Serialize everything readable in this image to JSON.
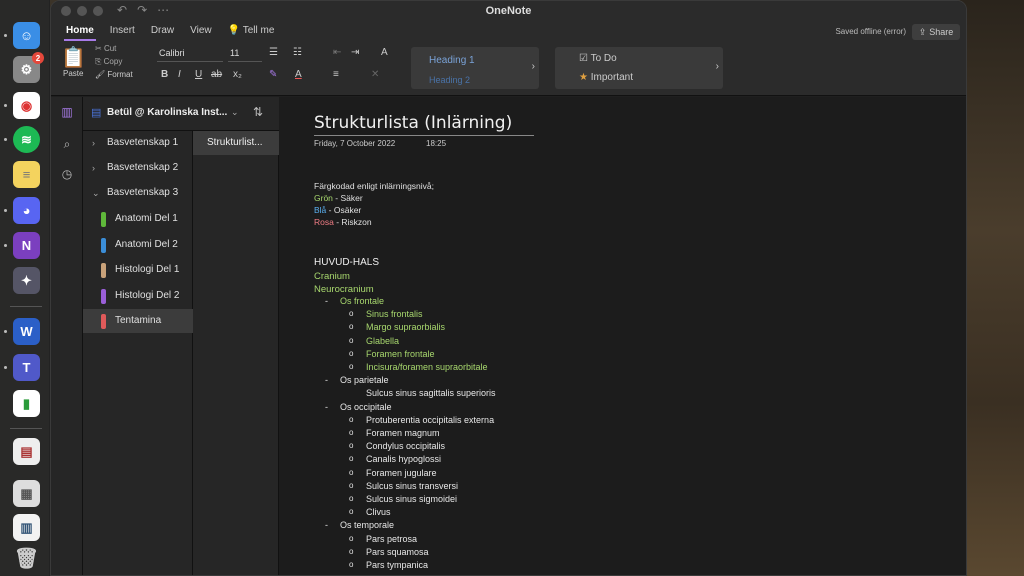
{
  "window": {
    "app_title": "OneNote"
  },
  "menu": {
    "tabs": [
      "Home",
      "Insert",
      "Draw",
      "View"
    ],
    "tell_me": "Tell me",
    "saved_status": "Saved offline (error)",
    "share": "Share"
  },
  "ribbon": {
    "paste": "Paste",
    "cut": "Cut",
    "copy": "Copy",
    "format": "Format",
    "font": "Calibri",
    "size": "11",
    "styles": {
      "primary": "Heading 1",
      "secondary": "Heading 2"
    },
    "tags": {
      "todo": "To Do",
      "important": "Important"
    }
  },
  "notebook": {
    "name": "Betül @ Karolinska Inst..."
  },
  "sections": [
    {
      "label": "Basvetenskap 1",
      "chevron": "›",
      "color": ""
    },
    {
      "label": "Basvetenskap 2",
      "chevron": "›",
      "color": ""
    },
    {
      "label": "Basvetenskap 3",
      "chevron": "⌄",
      "color": ""
    },
    {
      "label": "Anatomi Del 1",
      "chevron": "",
      "color": "#5fb83a"
    },
    {
      "label": "Anatomi Del 2",
      "chevron": "",
      "color": "#3b8ed8"
    },
    {
      "label": "Histologi Del 1",
      "chevron": "",
      "color": "#c9a27a"
    },
    {
      "label": "Histologi Del 2",
      "chevron": "",
      "color": "#9a5fd8"
    },
    {
      "label": "Tentamina",
      "chevron": "",
      "color": "#e05a5a"
    }
  ],
  "pages": [
    {
      "label": "Strukturlist..."
    }
  ],
  "note": {
    "title": "Strukturlista (Inlärning)",
    "date": "Friday, 7 October 2022",
    "time": "18:25",
    "legend_intro": "Färgkodad enligt inlärningsnivå;",
    "legend": [
      {
        "color_word": "Grön",
        "rest": " - Säker",
        "cls": "green"
      },
      {
        "color_word": "Blå",
        "rest": " - Osäker",
        "cls": "blue"
      },
      {
        "color_word": "Rosa",
        "rest": " - Riskzon",
        "cls": "pink"
      }
    ],
    "heading": "HUVUD-HALS",
    "cranium": "Cranium",
    "neurocranium": "Neurocranium",
    "outline": [
      {
        "level": 1,
        "text": "Os frontale",
        "cls": "green"
      },
      {
        "level": 2,
        "text": "Sinus frontalis",
        "cls": "green"
      },
      {
        "level": 2,
        "text": "Margo supraorbialis",
        "cls": "green"
      },
      {
        "level": 2,
        "text": "Glabella",
        "cls": "green"
      },
      {
        "level": 2,
        "text": "Foramen frontale",
        "cls": "green"
      },
      {
        "level": 2,
        "text": "Incisura/foramen supraorbitale",
        "cls": "green"
      },
      {
        "level": 1,
        "text": "Os parietale",
        "cls": ""
      },
      {
        "level": 3,
        "text": "Sulcus sinus sagittalis superioris",
        "cls": ""
      },
      {
        "level": 1,
        "text": "Os occipitale",
        "cls": ""
      },
      {
        "level": 2,
        "text": "Protuberentia occipitalis externa",
        "cls": ""
      },
      {
        "level": 2,
        "text": "Foramen magnum",
        "cls": ""
      },
      {
        "level": 2,
        "text": "Condylus occipitalis",
        "cls": ""
      },
      {
        "level": 2,
        "text": "Canalis hypoglossi",
        "cls": ""
      },
      {
        "level": 2,
        "text": "Foramen jugulare",
        "cls": ""
      },
      {
        "level": 2,
        "text": "Sulcus sinus transversi",
        "cls": ""
      },
      {
        "level": 2,
        "text": "Sulcus sinus sigmoidei",
        "cls": ""
      },
      {
        "level": 2,
        "text": "Clivus",
        "cls": ""
      },
      {
        "level": 1,
        "text": "Os temporale",
        "cls": ""
      },
      {
        "level": 2,
        "text": "Pars petrosa",
        "cls": ""
      },
      {
        "level": 2,
        "text": "Pars squamosa",
        "cls": ""
      },
      {
        "level": 2,
        "text": "Pars tympanica",
        "cls": ""
      }
    ]
  }
}
